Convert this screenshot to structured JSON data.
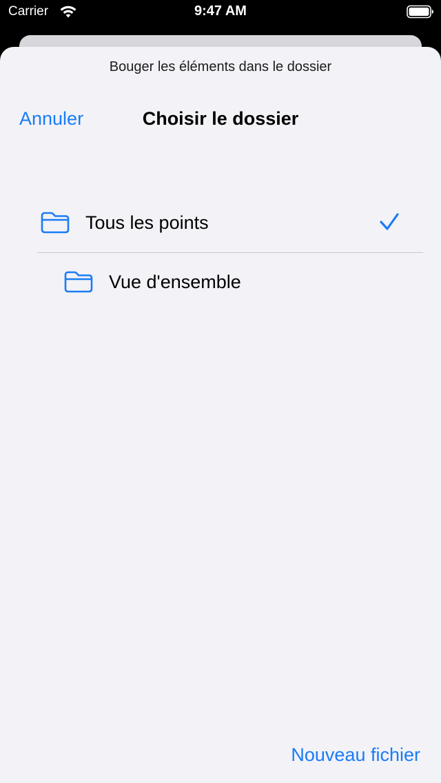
{
  "status_bar": {
    "carrier": "Carrier",
    "time": "9:47 AM"
  },
  "sheet": {
    "prompt": "Bouger les éléments dans le dossier",
    "cancel_label": "Annuler",
    "title": "Choisir le dossier",
    "new_file_label": "Nouveau fichier"
  },
  "folders": [
    {
      "label": "Tous les points",
      "selected": true,
      "icon": "folder-icon"
    },
    {
      "label": "Vue d'ensemble",
      "selected": false,
      "icon": "folder-icon"
    }
  ],
  "colors": {
    "accent": "#1a7cf5",
    "background": "#f2f2f7"
  }
}
